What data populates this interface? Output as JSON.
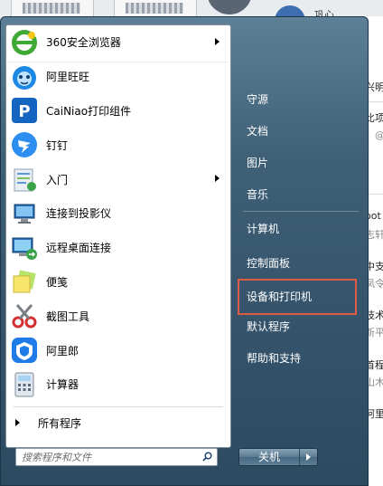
{
  "background": {
    "partial_texts": [
      "巩心",
      "兴明",
      "比项",
      "：@",
      "oot",
      "志轩",
      "中支",
      "凤令",
      "技术",
      "新平",
      "首程",
      "山木",
      "阿里"
    ]
  },
  "programs": [
    {
      "label": "360安全浏览器",
      "icon": "browser-360-icon",
      "has_submenu": true
    },
    {
      "label": "阿里旺旺",
      "icon": "aliwangwang-icon",
      "has_submenu": false
    },
    {
      "label": "CaiNiao打印组件",
      "icon": "cainiao-print-icon",
      "has_submenu": false
    },
    {
      "label": "钉钉",
      "icon": "dingtalk-icon",
      "has_submenu": false
    },
    {
      "label": "入门",
      "icon": "getting-started-icon",
      "has_submenu": true
    },
    {
      "label": "连接到投影仪",
      "icon": "projector-icon",
      "has_submenu": false
    },
    {
      "label": "远程桌面连接",
      "icon": "remote-desktop-icon",
      "has_submenu": false
    },
    {
      "label": "便笺",
      "icon": "sticky-notes-icon",
      "has_submenu": false
    },
    {
      "label": "截图工具",
      "icon": "snipping-tool-icon",
      "has_submenu": false
    },
    {
      "label": "阿里郎",
      "icon": "alilang-icon",
      "has_submenu": false
    },
    {
      "label": "计算器",
      "icon": "calculator-icon",
      "has_submenu": false
    }
  ],
  "all_programs": "所有程序",
  "search": {
    "placeholder": "搜索程序和文件"
  },
  "right": {
    "items": [
      "守源",
      "文档",
      "图片",
      "音乐",
      "计算机",
      "控制面板",
      "设备和打印机",
      "默认程序",
      "帮助和支持"
    ],
    "highlighted": "设备和打印机"
  },
  "shutdown": {
    "label": "关机"
  },
  "colors": {
    "menu_bg": "#3f6076",
    "highlight_border": "#e05a44"
  }
}
